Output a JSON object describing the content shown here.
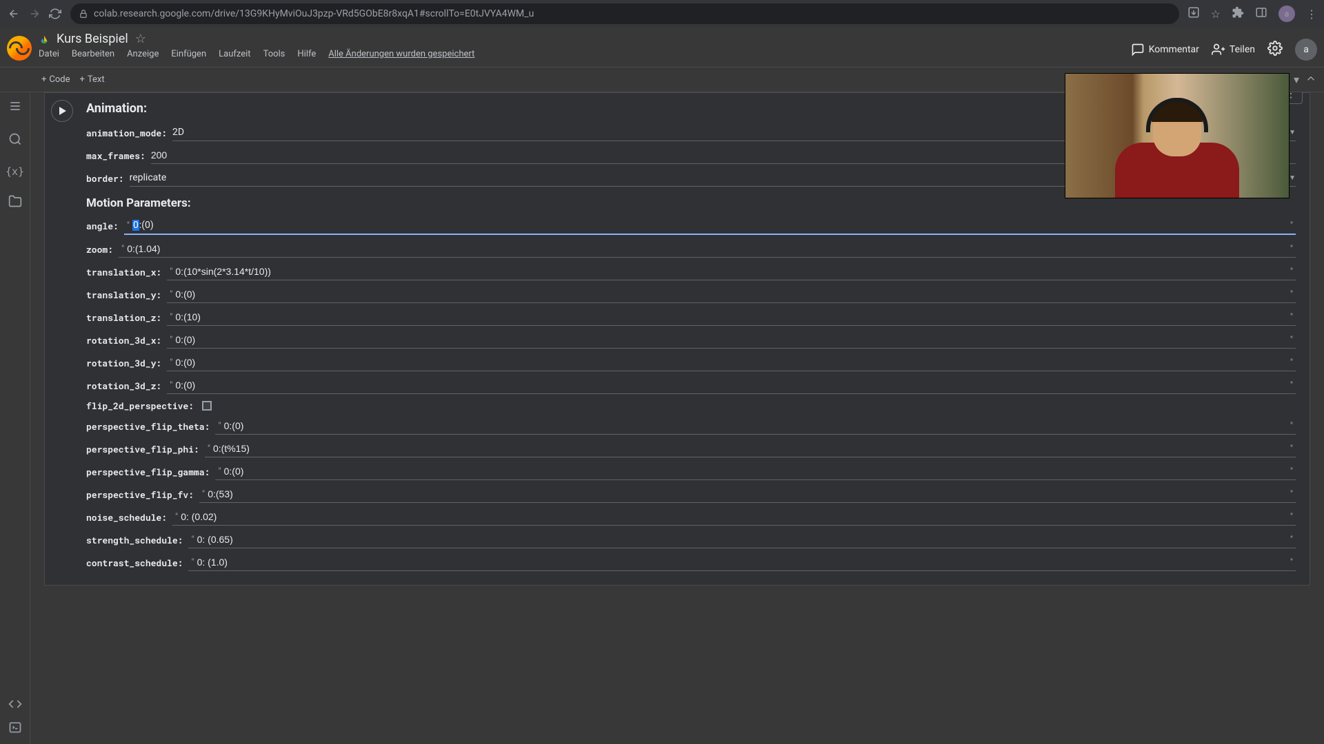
{
  "browser": {
    "url": "colab.research.google.com/drive/13G9KHyMviOuJ3pzp-VRd5GObE8r8xqA1#scrollTo=E0tJVYA4WM_u"
  },
  "header": {
    "doc_title": "Kurs Beispiel",
    "menu": [
      "Datei",
      "Bearbeiten",
      "Anzeige",
      "Einfügen",
      "Laufzeit",
      "Tools",
      "Hilfe"
    ],
    "save_status": "Alle Änderungen wurden gespeichert",
    "comment": "Kommentar",
    "share": "Teilen",
    "avatar_letter": "a"
  },
  "toolbar": {
    "code_btn": "Code",
    "text_btn": "Text"
  },
  "cell": {
    "section1_title": "Animation:",
    "animation_mode": {
      "label": "animation_mode:",
      "value": "2D"
    },
    "max_frames": {
      "label": "max_frames:",
      "value": "200"
    },
    "border": {
      "label": "border:",
      "value": "replicate"
    },
    "section2_title": "Motion Parameters:",
    "angle": {
      "label": "angle:",
      "value": "0:(0)",
      "highlighted_char": "0"
    },
    "zoom": {
      "label": "zoom:",
      "value": "0:(1.04)"
    },
    "translation_x": {
      "label": "translation_x:",
      "value": "0:(10*sin(2*3.14*t/10))"
    },
    "translation_y": {
      "label": "translation_y:",
      "value": "0:(0)"
    },
    "translation_z": {
      "label": "translation_z:",
      "value": "0:(10)"
    },
    "rotation_3d_x": {
      "label": "rotation_3d_x:",
      "value": "0:(0)"
    },
    "rotation_3d_y": {
      "label": "rotation_3d_y:",
      "value": "0:(0)"
    },
    "rotation_3d_z": {
      "label": "rotation_3d_z:",
      "value": "0:(0)"
    },
    "flip_2d_perspective": {
      "label": "flip_2d_perspective:",
      "checked": false
    },
    "perspective_flip_theta": {
      "label": "perspective_flip_theta:",
      "value": "0:(0)"
    },
    "perspective_flip_phi": {
      "label": "perspective_flip_phi:",
      "value": "0:(t%15)"
    },
    "perspective_flip_gamma": {
      "label": "perspective_flip_gamma:",
      "value": "0:(0)"
    },
    "perspective_flip_fv": {
      "label": "perspective_flip_fv:",
      "value": "0:(53)"
    },
    "noise_schedule": {
      "label": "noise_schedule:",
      "value": "0: (0.02)"
    },
    "strength_schedule": {
      "label": "strength_schedule:",
      "value": "0: (0.65)"
    },
    "contrast_schedule": {
      "label": "contrast_schedule:",
      "value": "0: (1.0)"
    }
  }
}
